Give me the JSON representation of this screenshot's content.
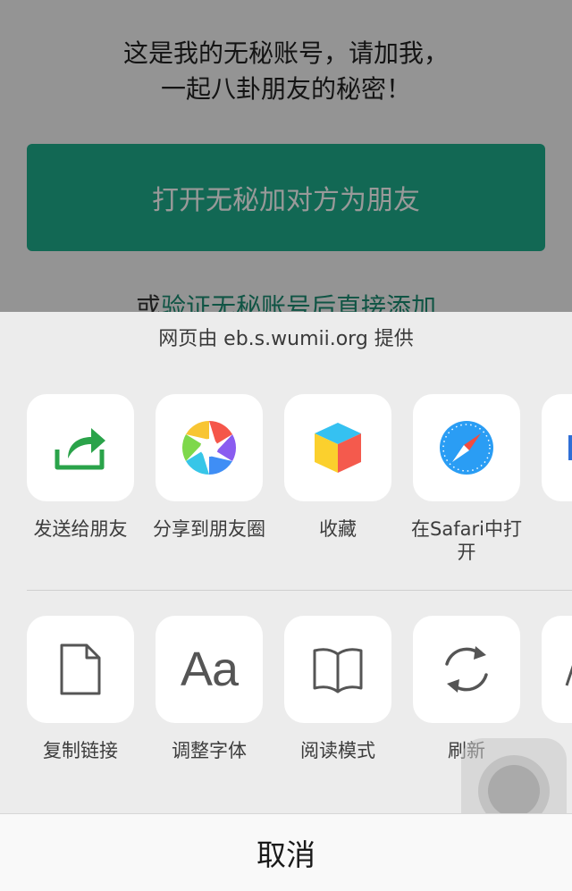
{
  "background": {
    "intro_line1": "这是我的无秘账号，请加我，",
    "intro_line2": "一起八卦朋友的秘密！",
    "open_button": "打开无秘加对方为朋友",
    "link_prefix": "或",
    "link_text": "验证无秘账号后直接添加"
  },
  "sheet": {
    "provider": "网页由 eb.s.wumii.org 提供",
    "top_row": [
      {
        "label": "发送给朋友",
        "icon": "share-arrow-icon"
      },
      {
        "label": "分享到朋友圈",
        "icon": "moments-aperture-icon"
      },
      {
        "label": "收藏",
        "icon": "favorites-cube-icon"
      },
      {
        "label": "在Safari中打开",
        "icon": "safari-compass-icon"
      }
    ],
    "bottom_row": [
      {
        "label": "复制链接",
        "icon": "document-icon"
      },
      {
        "label": "调整字体",
        "icon": "font-icon",
        "glyph": "Aa"
      },
      {
        "label": "阅读模式",
        "icon": "book-icon"
      },
      {
        "label": "刷新",
        "icon": "refresh-icon"
      }
    ],
    "cancel": "取消"
  },
  "colors": {
    "accent_green": "#1fae8c",
    "share_green": "#2aa34a"
  }
}
